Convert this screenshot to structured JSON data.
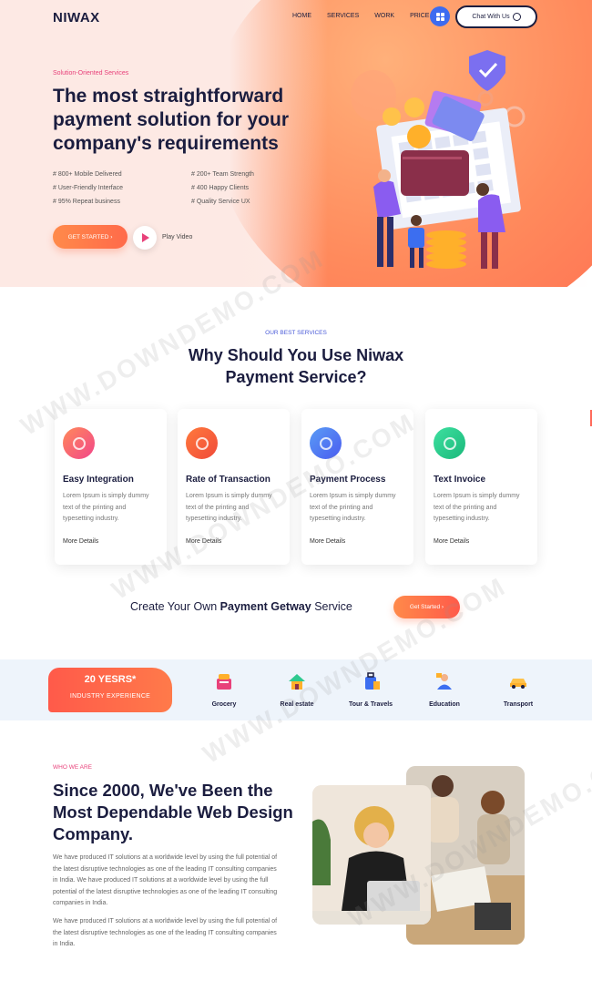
{
  "header": {
    "logo": "NIWAX",
    "nav": [
      "HOME",
      "SERVICES",
      "WORK",
      "PRICE"
    ],
    "chat_label": "Chat With Us"
  },
  "hero": {
    "tagline": "Solution-Oriented Services",
    "title": "The most straightforward payment solution for your company's requirements",
    "features": [
      "# 800+ Mobile Delivered",
      "# 200+ Team Strength",
      "# User-Friendly Interface",
      "# 400 Happy Clients",
      "# 95% Repeat business",
      "# Quality Service UX"
    ],
    "cta_label": "GET STARTED ›",
    "play_label": "Play Video"
  },
  "services": {
    "tag": "OUR BEST SERVICES",
    "title_line1": "Why Should You Use Niwax",
    "title_line2": "Payment Service?",
    "cards": [
      {
        "title": "Easy Integration",
        "desc": "Lorem Ipsum is simply dummy text of the printing and typesetting industry.",
        "more": "More Details",
        "color": "#f2458a"
      },
      {
        "title": "Rate of Transaction",
        "desc": "Lorem Ipsum is simply dummy text of the printing and typesetting industry.",
        "more": "More Details",
        "color": "#ff6a3d"
      },
      {
        "title": "Payment Process",
        "desc": "Lorem Ipsum is simply dummy text of the printing and typesetting industry.",
        "more": "More Details",
        "color": "#4a7cf0"
      },
      {
        "title": "Text Invoice",
        "desc": "Lorem Ipsum is simply dummy text of the printing and typesetting industry.",
        "more": "More Details",
        "color": "#2ec98f"
      }
    ],
    "create_pre": "Create Your Own ",
    "create_bold": "Payment Getway",
    "create_post": " Service",
    "cta_label": "Get Started ›"
  },
  "industries": {
    "years": "20 YESRS*",
    "exp_label": "INDUSTRY EXPERIENCE",
    "items": [
      {
        "label": "Grocery",
        "icon": "grocery-icon"
      },
      {
        "label": "Real estate",
        "icon": "real-estate-icon"
      },
      {
        "label": "Tour & Travels",
        "icon": "travel-icon"
      },
      {
        "label": "Education",
        "icon": "education-icon"
      },
      {
        "label": "Transport",
        "icon": "transport-icon"
      }
    ]
  },
  "about": {
    "tag": "WHO WE ARE",
    "title": "Since 2000, We've Been the Most Dependable Web Design Company.",
    "para1": "We have produced IT solutions at a worldwide level by using the full potential of the latest disruptive technologies as one of the leading IT consulting companies in India. We have produced IT solutions at a worldwide level by using the full potential of the latest disruptive technologies as one of the leading IT consulting companies in India.",
    "para2": "We have produced IT solutions at a worldwide level by using the full potential of the latest disruptive technologies as one of the leading IT consulting companies in India."
  },
  "watermark": "WWW.DOWNDEMO.COM"
}
